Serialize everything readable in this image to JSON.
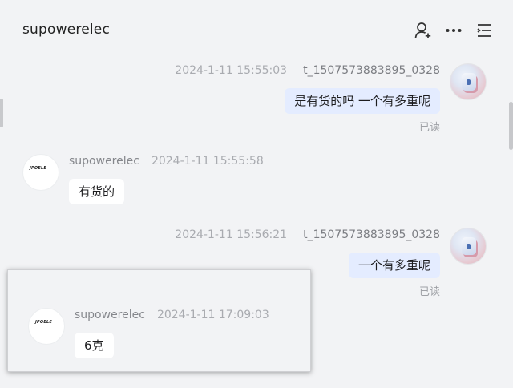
{
  "header": {
    "title": "supowerelec",
    "icons": [
      "add-user-icon",
      "more-icon",
      "menu-list-icon"
    ]
  },
  "messages": [
    {
      "direction": "out",
      "time": "2024-1-11 15:55:03",
      "sender": "t_1507573883895_0328",
      "text": "是有货的吗 一个有多重呢",
      "status": "已读"
    },
    {
      "direction": "in",
      "time": "2024-1-11 15:55:58",
      "sender": "supowerelec",
      "text": "有货的"
    },
    {
      "direction": "out",
      "time": "2024-1-11 15:56:21",
      "sender": "t_1507573883895_0328",
      "text": "一个有多重呢",
      "status": "已读"
    },
    {
      "direction": "in",
      "time": "2024-1-11 17:09:03",
      "sender": "supowerelec",
      "text": "6克"
    }
  ],
  "shop_logo_text": "JPOELE",
  "colors": {
    "background": "#f2f3f5",
    "outgoing_bubble": "#e4ecff",
    "incoming_bubble": "#ffffff",
    "meta_text": "#a9abb0"
  }
}
